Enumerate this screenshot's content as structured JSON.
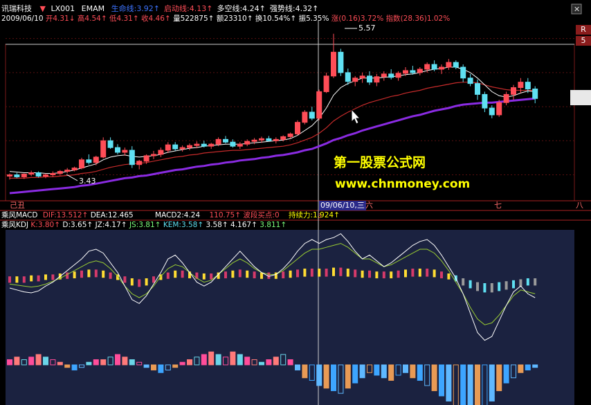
{
  "colors": {
    "up": "#ff4d57",
    "down": "#5fe0f2",
    "ma_white": "#ffffff",
    "ma_red": "#c72b2b",
    "ma_purple": "#8a2be2",
    "yellow": "#ffff00",
    "panel_bg": "#1b2240"
  },
  "header": {
    "stock_name": "讯瑞科技",
    "indicator_code": "LX001",
    "indicator_name": "EMAM",
    "items": [
      {
        "label": "生命线:",
        "value": "3.92",
        "arrow": "↑",
        "color": "#3d74ff"
      },
      {
        "label": "启动线:",
        "value": "4.13",
        "arrow": "↑",
        "color": "#ff4d57"
      },
      {
        "label": "多空线:",
        "value": "4.24",
        "arrow": "↑",
        "color": "#ffffff"
      },
      {
        "label": "强势线:",
        "value": "4.32",
        "arrow": "↑",
        "color": "#ffffff"
      }
    ]
  },
  "quote_line": {
    "date": "2009/06/10",
    "open_label": "开",
    "open": "4.31",
    "high_label": "高",
    "high": "4.54",
    "low_label": "低",
    "low": "4.31",
    "close_label": "收",
    "close": "4.46",
    "vol_label": "量",
    "vol": "522875",
    "amt_label": "额",
    "amt": "23310",
    "turn_label": "换",
    "turn": "10.54%",
    "amp_label": "振",
    "amp": "5.35%",
    "chg_label": "涨",
    "chg": "(0.16)",
    "chg_pct": "3.72%",
    "idx_label": "指数",
    "idx": "(28.36)",
    "idx_pct": "1.02%"
  },
  "annotations": {
    "high_mark": "5.57",
    "low_mark": "3.43",
    "cursor_tag": "3"
  },
  "watermark": {
    "line1": "第一股票公式网",
    "line2": "www.chnmoney.com"
  },
  "date_axis": {
    "left": "己丑",
    "cursor": "09/06/10,三",
    "mid": "六",
    "right1": "七",
    "right2": "八"
  },
  "macd_header": {
    "name": "乘风MACD",
    "dif_label": "DIF:",
    "dif": "13.512",
    "dif_arrow": "↑",
    "dea_label": "DEA:",
    "dea": "12.465",
    "macd2_label": "MACD2:",
    "macd2": "4.24",
    "extra": "110.75",
    "extra_arrow": "↑",
    "buy_label": "波段买点:",
    "buy": "0",
    "hold_label": "持续力:",
    "hold": "1.924",
    "hold_arrow": "↑"
  },
  "kdj_header": {
    "name": "乘风KDJ",
    "k_label": "K:",
    "k": "3.80",
    "k_arrow": "↑",
    "d_label": "D:",
    "d": "3.65",
    "d_arrow": "↑",
    "jz_label": "JZ:",
    "jz": "4.17",
    "jz_arrow": "↑",
    "js_label": "JS:",
    "js": "3.81",
    "js_arrow": "↑",
    "kem_label": "KEM:",
    "kem": "3.58",
    "kem_arrow": "↑",
    "v1": "3.58",
    "v1_arrow": "↑",
    "v2": "4.167",
    "v2_arrow": "↑",
    "v3": "3.811",
    "v3_arrow": "↑"
  },
  "side_labels": [
    "R",
    "5"
  ],
  "chart_data": {
    "type": "candlestick",
    "ylim": [
      3.2,
      5.7
    ],
    "candles": [
      [
        3.48,
        3.52,
        3.43,
        3.5
      ],
      [
        3.5,
        3.53,
        3.45,
        3.47
      ],
      [
        3.47,
        3.52,
        3.44,
        3.51
      ],
      [
        3.51,
        3.56,
        3.48,
        3.53
      ],
      [
        3.53,
        3.55,
        3.46,
        3.48
      ],
      [
        3.48,
        3.52,
        3.45,
        3.5
      ],
      [
        3.5,
        3.55,
        3.47,
        3.52
      ],
      [
        3.52,
        3.57,
        3.49,
        3.55
      ],
      [
        3.55,
        3.6,
        3.52,
        3.57
      ],
      [
        3.57,
        3.62,
        3.55,
        3.6
      ],
      [
        3.6,
        3.75,
        3.58,
        3.72
      ],
      [
        3.72,
        3.8,
        3.65,
        3.68
      ],
      [
        3.68,
        3.78,
        3.64,
        3.76
      ],
      [
        3.76,
        4.05,
        3.74,
        4.0
      ],
      [
        4.0,
        4.05,
        3.88,
        3.9
      ],
      [
        3.9,
        3.95,
        3.8,
        3.83
      ],
      [
        3.83,
        3.9,
        3.78,
        3.86
      ],
      [
        3.86,
        3.92,
        3.6,
        3.65
      ],
      [
        3.65,
        3.72,
        3.58,
        3.7
      ],
      [
        3.7,
        3.8,
        3.66,
        3.78
      ],
      [
        3.78,
        3.85,
        3.73,
        3.8
      ],
      [
        3.8,
        3.9,
        3.76,
        3.86
      ],
      [
        3.86,
        3.98,
        3.82,
        3.94
      ],
      [
        3.94,
        3.98,
        3.85,
        3.88
      ],
      [
        3.88,
        3.93,
        3.84,
        3.9
      ],
      [
        3.9,
        3.96,
        3.86,
        3.93
      ],
      [
        3.93,
        3.99,
        3.89,
        3.95
      ],
      [
        3.95,
        4.0,
        3.9,
        3.92
      ],
      [
        3.92,
        3.97,
        3.88,
        3.95
      ],
      [
        3.95,
        4.05,
        3.92,
        4.02
      ],
      [
        4.02,
        4.07,
        3.96,
        3.98
      ],
      [
        3.98,
        4.02,
        3.9,
        3.92
      ],
      [
        3.92,
        3.98,
        3.88,
        3.95
      ],
      [
        3.95,
        4.02,
        3.92,
        3.99
      ],
      [
        3.99,
        4.04,
        3.95,
        4.01
      ],
      [
        4.01,
        4.06,
        3.97,
        4.03
      ],
      [
        4.03,
        4.07,
        3.99,
        4.0
      ],
      [
        4.0,
        4.05,
        3.96,
        4.02
      ],
      [
        4.02,
        4.08,
        3.99,
        4.06
      ],
      [
        4.06,
        4.12,
        4.03,
        4.1
      ],
      [
        4.1,
        4.3,
        4.08,
        4.27
      ],
      [
        4.27,
        4.45,
        4.24,
        4.42
      ],
      [
        4.42,
        4.5,
        4.3,
        4.33
      ],
      [
        4.33,
        4.75,
        4.3,
        4.72
      ],
      [
        4.72,
        5.0,
        4.7,
        4.95
      ],
      [
        4.95,
        5.57,
        4.92,
        5.3
      ],
      [
        5.3,
        5.35,
        4.95,
        5.0
      ],
      [
        5.0,
        5.06,
        4.82,
        4.87
      ],
      [
        4.87,
        4.95,
        4.8,
        4.92
      ],
      [
        4.92,
        5.0,
        4.85,
        4.95
      ],
      [
        4.95,
        5.02,
        4.82,
        4.86
      ],
      [
        4.86,
        4.98,
        4.8,
        4.94
      ],
      [
        4.94,
        5.02,
        4.88,
        4.98
      ],
      [
        4.98,
        5.05,
        4.9,
        4.93
      ],
      [
        4.93,
        5.02,
        4.88,
        4.99
      ],
      [
        4.99,
        5.08,
        4.95,
        5.03
      ],
      [
        5.03,
        5.1,
        4.97,
        5.0
      ],
      [
        5.0,
        5.08,
        4.96,
        5.05
      ],
      [
        5.05,
        5.15,
        5.0,
        5.12
      ],
      [
        5.12,
        5.18,
        5.02,
        5.05
      ],
      [
        5.05,
        5.12,
        4.98,
        5.08
      ],
      [
        5.08,
        5.2,
        5.04,
        5.15
      ],
      [
        5.15,
        5.18,
        5.05,
        5.08
      ],
      [
        5.08,
        5.12,
        4.86,
        4.92
      ],
      [
        4.92,
        4.98,
        4.8,
        4.84
      ],
      [
        4.84,
        4.9,
        4.6,
        4.68
      ],
      [
        4.68,
        4.72,
        4.42,
        4.48
      ],
      [
        4.48,
        4.52,
        4.33,
        4.38
      ],
      [
        4.38,
        4.6,
        4.35,
        4.56
      ],
      [
        4.56,
        4.72,
        4.52,
        4.68
      ],
      [
        4.68,
        4.82,
        4.6,
        4.78
      ],
      [
        4.78,
        4.92,
        4.7,
        4.86
      ],
      [
        4.86,
        4.92,
        4.7,
        4.76
      ],
      [
        4.76,
        4.8,
        4.55,
        4.62
      ]
    ],
    "ma_white": [
      3.55,
      3.54,
      3.53,
      3.53,
      3.53,
      3.52,
      3.52,
      3.53,
      3.55,
      3.57,
      3.6,
      3.63,
      3.66,
      3.72,
      3.76,
      3.78,
      3.79,
      3.77,
      3.76,
      3.77,
      3.78,
      3.8,
      3.83,
      3.85,
      3.87,
      3.89,
      3.9,
      3.92,
      3.93,
      3.94,
      3.95,
      3.95,
      3.95,
      3.96,
      3.97,
      3.98,
      3.99,
      4.0,
      4.01,
      4.03,
      4.08,
      4.15,
      4.22,
      4.33,
      4.48,
      4.67,
      4.78,
      4.84,
      4.88,
      4.92,
      4.92,
      4.92,
      4.93,
      4.94,
      4.95,
      4.97,
      4.98,
      5.0,
      5.03,
      5.05,
      5.06,
      5.08,
      5.08,
      5.05,
      5.0,
      4.92,
      4.82,
      4.72,
      4.66,
      4.64,
      4.66,
      4.7,
      4.73,
      4.72
    ],
    "ma_red": [
      3.45,
      3.45,
      3.45,
      3.46,
      3.46,
      3.47,
      3.47,
      3.48,
      3.49,
      3.5,
      3.52,
      3.53,
      3.55,
      3.58,
      3.61,
      3.63,
      3.65,
      3.66,
      3.67,
      3.68,
      3.7,
      3.72,
      3.74,
      3.76,
      3.77,
      3.79,
      3.8,
      3.82,
      3.83,
      3.84,
      3.85,
      3.86,
      3.86,
      3.87,
      3.88,
      3.89,
      3.9,
      3.91,
      3.92,
      3.94,
      3.97,
      4.01,
      4.05,
      4.11,
      4.19,
      4.29,
      4.36,
      4.42,
      4.47,
      4.52,
      4.56,
      4.59,
      4.62,
      4.65,
      4.67,
      4.7,
      4.72,
      4.74,
      4.77,
      4.79,
      4.81,
      4.83,
      4.85,
      4.86,
      4.86,
      4.85,
      4.82,
      4.79,
      4.77,
      4.75,
      4.74,
      4.74,
      4.74,
      4.74
    ],
    "ma_purple": [
      3.23,
      3.24,
      3.25,
      3.26,
      3.27,
      3.28,
      3.29,
      3.3,
      3.31,
      3.32,
      3.34,
      3.35,
      3.37,
      3.39,
      3.41,
      3.43,
      3.45,
      3.46,
      3.48,
      3.49,
      3.51,
      3.53,
      3.55,
      3.57,
      3.58,
      3.6,
      3.62,
      3.63,
      3.65,
      3.66,
      3.68,
      3.69,
      3.71,
      3.72,
      3.73,
      3.75,
      3.76,
      3.78,
      3.79,
      3.81,
      3.83,
      3.86,
      3.88,
      3.92,
      3.96,
      4.01,
      4.04,
      4.08,
      4.11,
      4.15,
      4.18,
      4.21,
      4.24,
      4.27,
      4.3,
      4.33,
      4.36,
      4.38,
      4.41,
      4.44,
      4.46,
      4.48,
      4.51,
      4.53,
      4.54,
      4.55,
      4.56,
      4.56,
      4.57,
      4.58,
      4.59,
      4.6,
      4.61,
      4.62
    ],
    "kdj_white": [
      -10,
      -12,
      -14,
      -15,
      -13,
      -8,
      -4,
      2,
      8,
      14,
      20,
      28,
      30,
      26,
      16,
      6,
      -8,
      -22,
      -26,
      -18,
      -6,
      6,
      20,
      24,
      16,
      6,
      -4,
      -8,
      -4,
      4,
      12,
      20,
      28,
      20,
      12,
      6,
      2,
      4,
      10,
      18,
      28,
      36,
      40,
      36,
      40,
      42,
      46,
      38,
      28,
      20,
      24,
      18,
      12,
      16,
      22,
      28,
      34,
      38,
      40,
      34,
      24,
      12,
      0,
      -16,
      -36,
      -56,
      -64,
      -60,
      -44,
      -28,
      -14,
      -8,
      -16,
      -20
    ],
    "kdj_green": [
      -6,
      -7,
      -8,
      -9,
      -8,
      -6,
      -3,
      0,
      4,
      8,
      12,
      16,
      18,
      16,
      10,
      2,
      -8,
      -16,
      -20,
      -16,
      -8,
      2,
      10,
      14,
      12,
      6,
      0,
      -4,
      -2,
      4,
      10,
      16,
      20,
      16,
      10,
      6,
      4,
      4,
      8,
      14,
      20,
      26,
      30,
      30,
      32,
      34,
      36,
      32,
      26,
      20,
      20,
      16,
      12,
      14,
      18,
      22,
      26,
      30,
      30,
      26,
      18,
      8,
      -4,
      -16,
      -30,
      -42,
      -48,
      -46,
      -38,
      -28,
      -18,
      -12,
      -14,
      -16
    ],
    "kdj_band": [
      -2,
      -2,
      -2,
      -1,
      -1,
      0,
      0,
      1,
      2,
      3,
      4,
      5,
      5,
      4,
      2,
      0,
      -2,
      -4,
      -5,
      -4,
      -2,
      0,
      2,
      4,
      4,
      3,
      2,
      1,
      1,
      2,
      3,
      4,
      5,
      4,
      3,
      2,
      2,
      2,
      3,
      4,
      5,
      6,
      6,
      6,
      6,
      7,
      7,
      6,
      5,
      4,
      4,
      3,
      3,
      3,
      4,
      5,
      6,
      6,
      6,
      5,
      3,
      1,
      -1,
      -4,
      -6,
      -8,
      -9,
      -9,
      -8,
      -7,
      -6,
      -5,
      -4,
      -4
    ],
    "macd_bars": [
      2,
      3,
      2,
      3,
      4,
      3,
      2,
      1,
      -1,
      -2,
      -1,
      1,
      2,
      2,
      3,
      4,
      3,
      2,
      1,
      -1,
      -2,
      -3,
      -2,
      -1,
      1,
      2,
      3,
      4,
      5,
      4,
      3,
      5,
      4,
      3,
      2,
      1,
      2,
      3,
      4,
      2,
      -2,
      -5,
      -6,
      -8,
      -9,
      -10,
      -11,
      -9,
      -7,
      -5,
      -3,
      -4,
      -5,
      -6,
      -4,
      -3,
      -5,
      -6,
      -8,
      -10,
      -12,
      -14,
      -16,
      -18,
      -20,
      -22,
      -19,
      -14,
      -10,
      -7,
      -5,
      -3,
      -2,
      -1
    ]
  }
}
